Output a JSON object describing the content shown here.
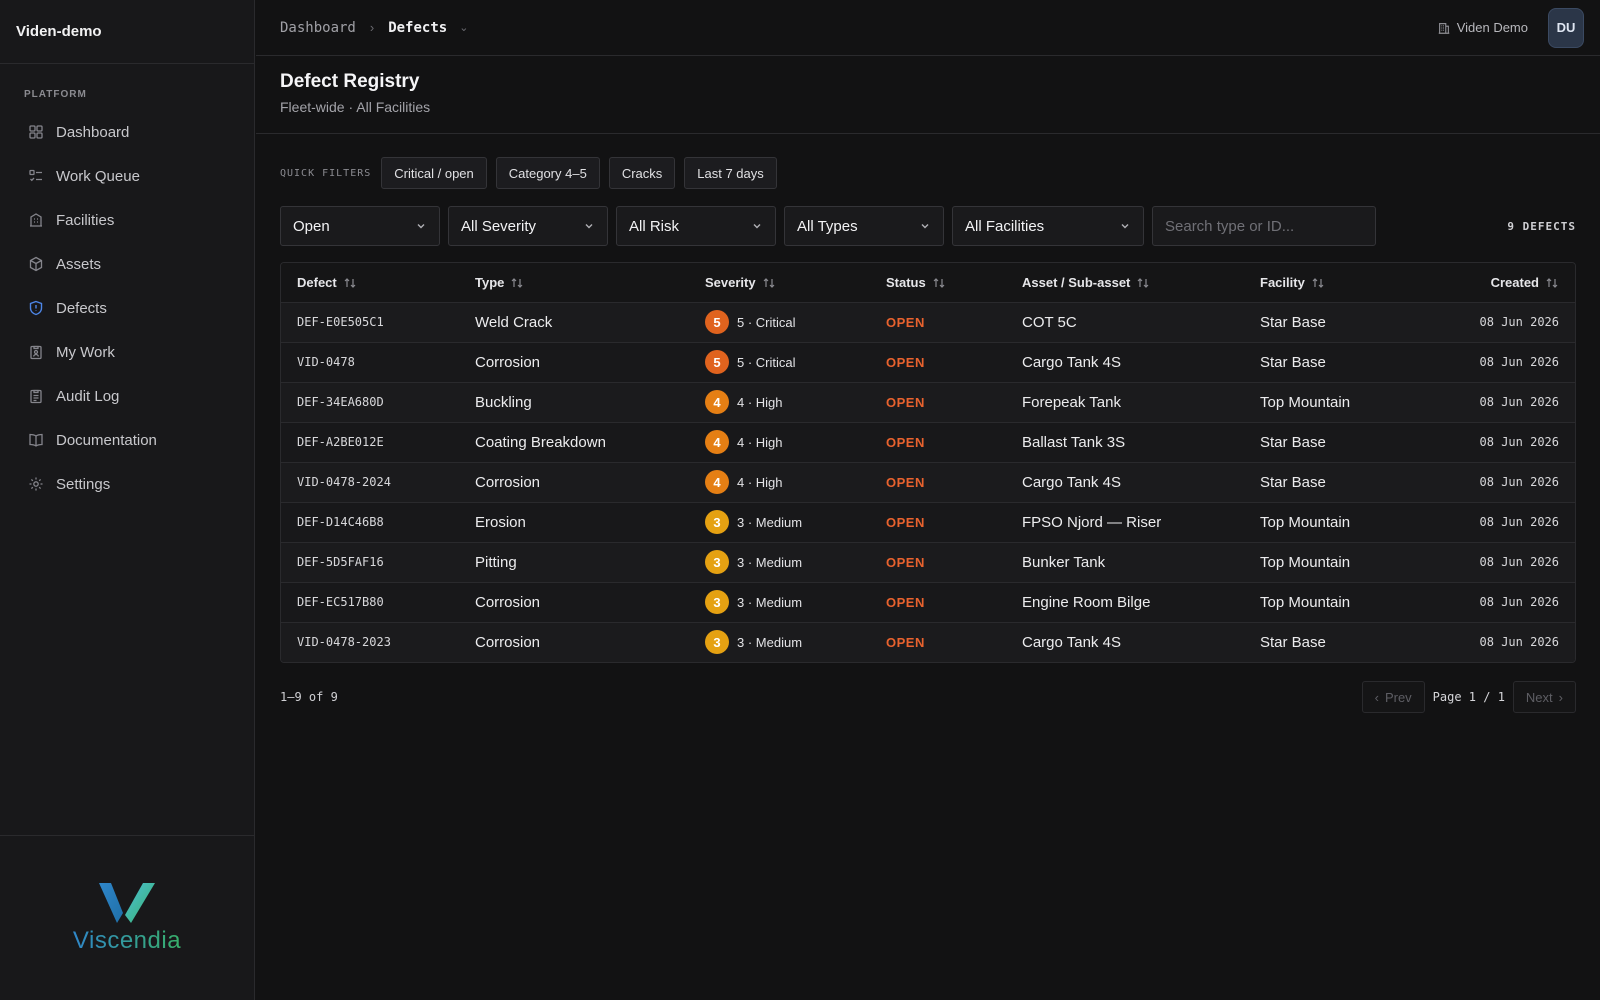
{
  "org": "Viden-demo",
  "nav": {
    "section_label": "PLATFORM",
    "items": [
      {
        "label": "Dashboard",
        "icon": "grid-icon"
      },
      {
        "label": "Work Queue",
        "icon": "list-check-icon"
      },
      {
        "label": "Facilities",
        "icon": "building-icon"
      },
      {
        "label": "Assets",
        "icon": "box-icon"
      },
      {
        "label": "Defects",
        "icon": "shield-alert-icon",
        "active": true
      },
      {
        "label": "My Work",
        "icon": "clipboard-user-icon"
      },
      {
        "label": "Audit Log",
        "icon": "clipboard-list-icon"
      },
      {
        "label": "Documentation",
        "icon": "book-icon"
      },
      {
        "label": "Settings",
        "icon": "gear-icon"
      }
    ]
  },
  "brand": {
    "name": "Viscendia",
    "colors": [
      "#2f86c9",
      "#38b06a"
    ]
  },
  "breadcrumb": {
    "parent": "Dashboard",
    "current": "Defects"
  },
  "tenant": "Viden Demo",
  "avatar": "DU",
  "page": {
    "title": "Defect Registry",
    "subtitle": "Fleet-wide · All Facilities"
  },
  "quick_filters": {
    "label": "QUICK FILTERS",
    "chips": [
      "Critical / open",
      "Category 4–5",
      "Cracks",
      "Last 7 days"
    ]
  },
  "filters": {
    "status": "Open",
    "severity": "All Severity",
    "risk": "All Risk",
    "types": "All Types",
    "facilities": "All Facilities",
    "search_placeholder": "Search type or ID...",
    "count": "9 DEFECTS"
  },
  "table": {
    "columns": [
      "Defect",
      "Type",
      "Severity",
      "Status",
      "Asset / Sub-asset",
      "Facility",
      "Created"
    ],
    "rows": [
      {
        "id": "DEF-E0E505C1",
        "type": "Weld Crack",
        "sev_num": "5",
        "sev_label": "5 · Critical",
        "sev_color": "#e0631e",
        "status": "OPEN",
        "asset": "COT 5C",
        "facility": "Star Base",
        "created": "08 Jun 2026"
      },
      {
        "id": "VID-0478",
        "type": "Corrosion",
        "sev_num": "5",
        "sev_label": "5 · Critical",
        "sev_color": "#e0631e",
        "status": "OPEN",
        "asset": "Cargo Tank 4S",
        "facility": "Star Base",
        "created": "08 Jun 2026"
      },
      {
        "id": "DEF-34EA680D",
        "type": "Buckling",
        "sev_num": "4",
        "sev_label": "4 · High",
        "sev_color": "#e57f14",
        "status": "OPEN",
        "asset": "Forepeak Tank",
        "facility": "Top Mountain",
        "created": "08 Jun 2026"
      },
      {
        "id": "DEF-A2BE012E",
        "type": "Coating Breakdown",
        "sev_num": "4",
        "sev_label": "4 · High",
        "sev_color": "#e57f14",
        "status": "OPEN",
        "asset": "Ballast Tank 3S",
        "facility": "Star Base",
        "created": "08 Jun 2026"
      },
      {
        "id": "VID-0478-2024",
        "type": "Corrosion",
        "sev_num": "4",
        "sev_label": "4 · High",
        "sev_color": "#e57f14",
        "status": "OPEN",
        "asset": "Cargo Tank 4S",
        "facility": "Star Base",
        "created": "08 Jun 2026"
      },
      {
        "id": "DEF-D14C46B8",
        "type": "Erosion",
        "sev_num": "3",
        "sev_label": "3 · Medium",
        "sev_color": "#e5a112",
        "status": "OPEN",
        "asset": "FPSO Njord — Riser",
        "facility": "Top Mountain",
        "created": "08 Jun 2026"
      },
      {
        "id": "DEF-5D5FAF16",
        "type": "Pitting",
        "sev_num": "3",
        "sev_label": "3 · Medium",
        "sev_color": "#e5a112",
        "status": "OPEN",
        "asset": "Bunker Tank",
        "facility": "Top Mountain",
        "created": "08 Jun 2026"
      },
      {
        "id": "DEF-EC517B80",
        "type": "Corrosion",
        "sev_num": "3",
        "sev_label": "3 · Medium",
        "sev_color": "#e5a112",
        "status": "OPEN",
        "asset": "Engine Room Bilge",
        "facility": "Top Mountain",
        "created": "08 Jun 2026"
      },
      {
        "id": "VID-0478-2023",
        "type": "Corrosion",
        "sev_num": "3",
        "sev_label": "3 · Medium",
        "sev_color": "#e5a112",
        "status": "OPEN",
        "asset": "Cargo Tank 4S",
        "facility": "Star Base",
        "created": "08 Jun 2026"
      }
    ]
  },
  "pagination": {
    "range": "1–9 of 9",
    "prev": "Prev",
    "page": "Page 1 / 1",
    "next": "Next"
  }
}
